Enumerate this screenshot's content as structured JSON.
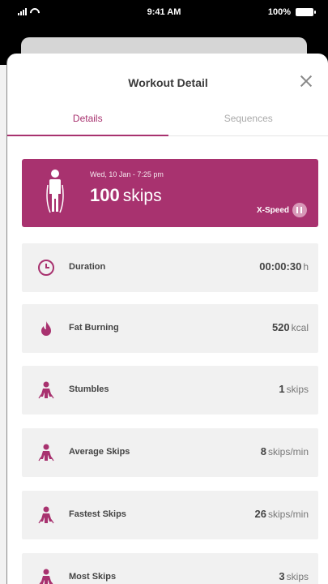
{
  "status_bar": {
    "time": "9:41 AM",
    "battery": "100%"
  },
  "header": {
    "title": "Workout Detail"
  },
  "tabs": [
    {
      "label": "Details",
      "active": true
    },
    {
      "label": "Sequences",
      "active": false
    }
  ],
  "summary": {
    "date": "Wed, 10 Jan - 7:25 pm",
    "count": "100",
    "unit": "skips",
    "mode_label": "X-Speed"
  },
  "stats": [
    {
      "label": "Duration",
      "value": "00:00:30",
      "unit": "h",
      "icon": "clock-icon"
    },
    {
      "label": "Fat Burning",
      "value": "520",
      "unit": "kcal",
      "icon": "flame-icon"
    },
    {
      "label": "Stumbles",
      "value": "1",
      "unit": "skips",
      "icon": "jumper-icon"
    },
    {
      "label": "Average Skips",
      "value": "8",
      "unit": "skips/min",
      "icon": "jumper-icon"
    },
    {
      "label": "Fastest Skips",
      "value": "26",
      "unit": "skips/min",
      "icon": "jumper-icon"
    },
    {
      "label": "Most Skips",
      "value": "3",
      "unit": "skips",
      "icon": "jumper-icon"
    }
  ],
  "colors": {
    "accent": "#a8326f",
    "row_bg": "#f1f1f1"
  }
}
